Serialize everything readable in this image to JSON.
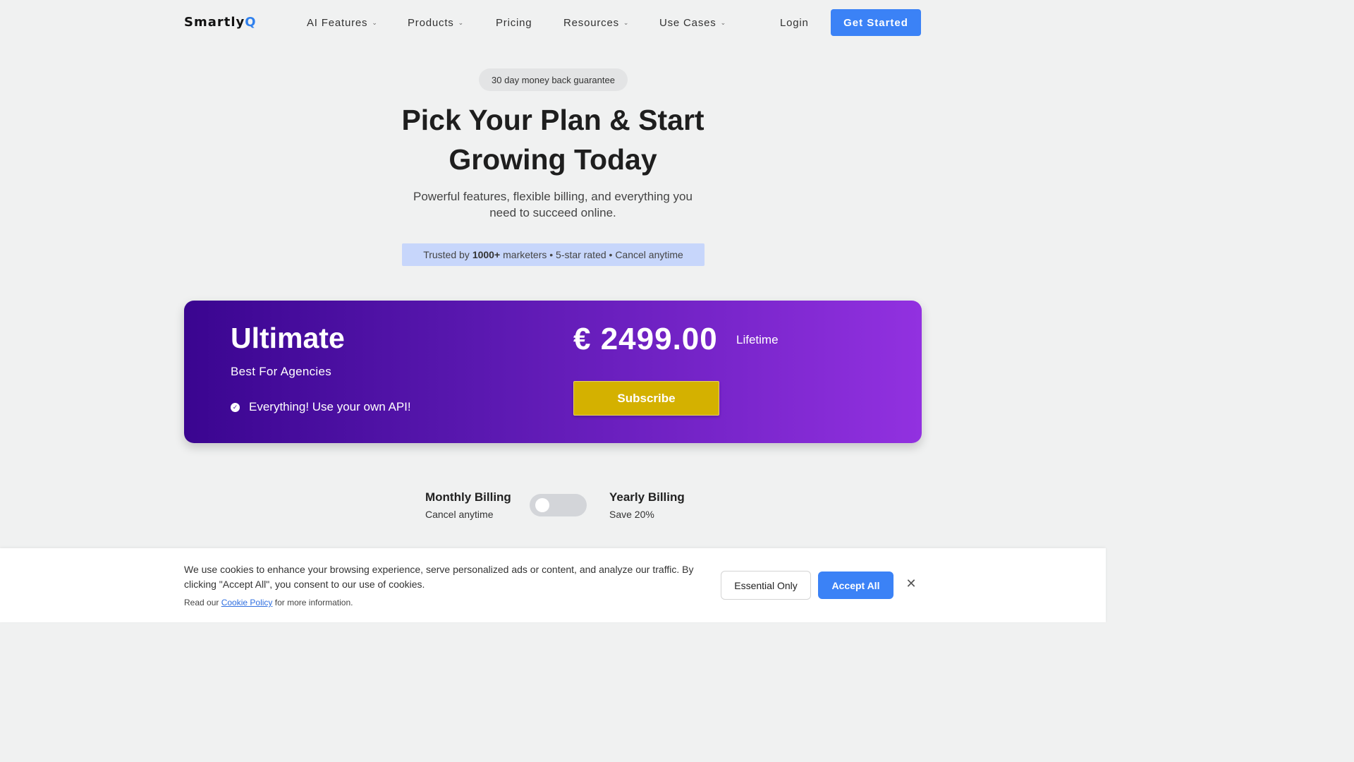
{
  "nav": {
    "logo_main": "Smartly",
    "logo_accent": "Q",
    "items": [
      {
        "label": "AI Features",
        "dropdown": true
      },
      {
        "label": "Products",
        "dropdown": true
      },
      {
        "label": "Pricing",
        "dropdown": false
      },
      {
        "label": "Resources",
        "dropdown": true
      },
      {
        "label": "Use Cases",
        "dropdown": true
      }
    ],
    "login": "Login",
    "cta": "Get Started"
  },
  "hero": {
    "badge": "30 day money back guarantee",
    "title_line1": "Pick Your Plan & Start",
    "title_line2": "Growing Today",
    "subtitle_line1": "Powerful features, flexible billing, and everything you",
    "subtitle_line2": "need to succeed online.",
    "trust_prefix": "Trusted by",
    "trust_count": "1000+",
    "trust_suffix": "marketers • 5-star rated • Cancel anytime"
  },
  "plan": {
    "name": "Ultimate",
    "tagline": "Best For Agencies",
    "feature": "Everything! Use your own API!",
    "price": "€ 2499.00",
    "period": "Lifetime",
    "button": "Subscribe"
  },
  "billing": {
    "monthly_title": "Monthly Billing",
    "monthly_sub": "Cancel anytime",
    "yearly_title": "Yearly Billing",
    "yearly_sub": "Save 20%",
    "yearly_selected": false
  },
  "cookie": {
    "text": "We use cookies to enhance your browsing experience, serve personalized ads or content, and analyze our traffic. By clicking \"Accept All\", you consent to our use of cookies.",
    "read_prefix": "Read our",
    "policy_link": "Cookie Policy",
    "read_suffix": "for more information.",
    "essential": "Essential Only",
    "accept": "Accept All"
  },
  "colors": {
    "accent": "#3b82f6",
    "card_gradient_start": "#3a0590",
    "card_gradient_end": "#9231e0",
    "subscribe": "#d4b100"
  }
}
